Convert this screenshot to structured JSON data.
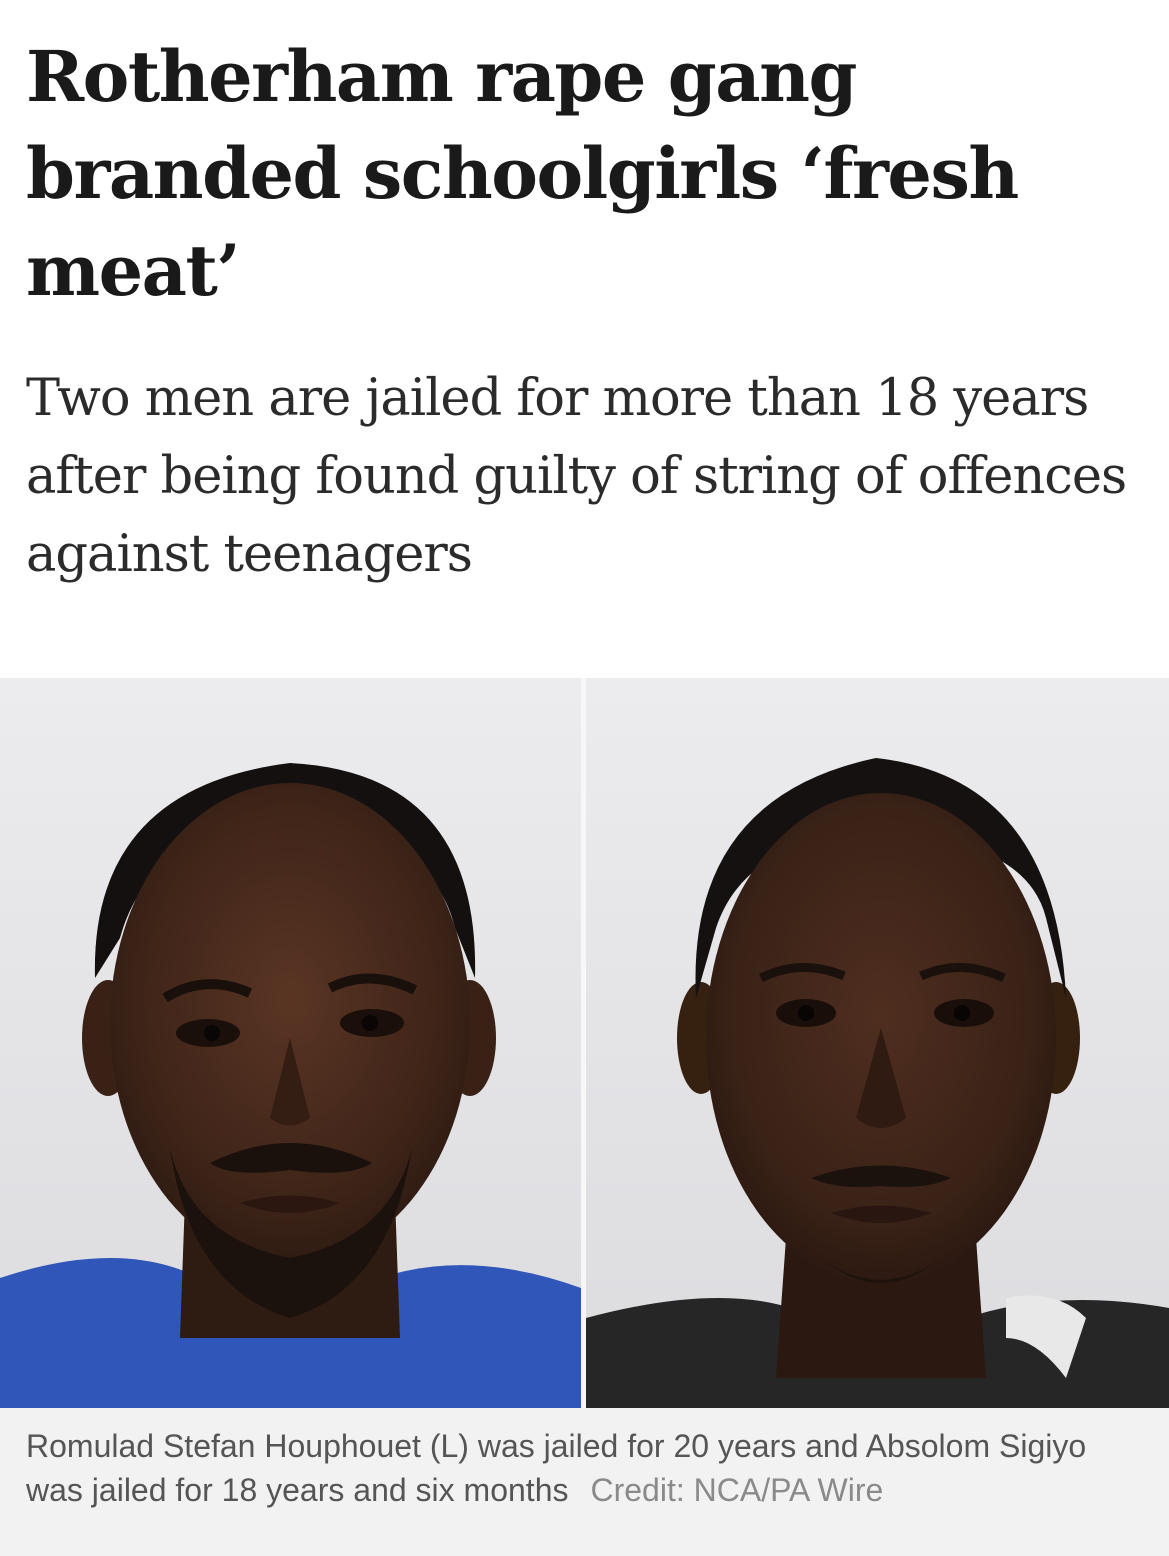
{
  "article": {
    "headline": "Rotherham rape gang branded schoolgirls ‘fresh meat’",
    "standfirst": "Two men are jailed for more than 18 years after being found guilty of string of offences against teenagers",
    "caption": "Romulad Stefan Houphouet (L) was jailed for 20 years and Absolom Sigiyo was jailed for 18 years and six months",
    "credit": "Credit: NCA/PA Wire"
  },
  "images": {
    "left": "police-custody-photo-left",
    "right": "police-custody-photo-right"
  },
  "colors": {
    "background": "#ffffff",
    "headline": "#1a1a1a",
    "standfirst": "#2b2b2b",
    "caption_bg": "#f2f2f2",
    "caption_text": "#555555",
    "credit_text": "#8a8a8a"
  }
}
